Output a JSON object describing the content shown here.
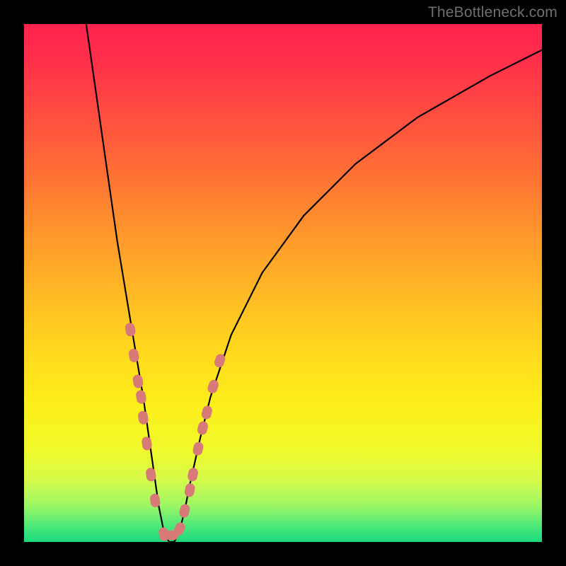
{
  "watermark": "TheBottleneck.com",
  "chart_data": {
    "type": "line",
    "title": "",
    "xlabel": "",
    "ylabel": "",
    "xlim": [
      0,
      100
    ],
    "ylim": [
      0,
      100
    ],
    "grid": false,
    "background_gradient": {
      "top": "#ff244e",
      "bottom": "#1bd97c"
    },
    "series": [
      {
        "name": "bottleneck-curve",
        "color": "#000000",
        "x": [
          12,
          14,
          16,
          18,
          20,
          21,
          22,
          23,
          24,
          25,
          26,
          27,
          28,
          29,
          30,
          31,
          32,
          34,
          36,
          40,
          46,
          54,
          64,
          76,
          90,
          100
        ],
        "y": [
          100,
          86,
          72,
          58,
          46,
          40,
          34,
          28,
          21,
          14,
          7,
          2,
          0,
          0,
          2,
          6,
          11,
          20,
          28,
          40,
          52,
          63,
          73,
          82,
          90,
          95
        ]
      }
    ],
    "markers": {
      "name": "data-points",
      "color": "#d77a78",
      "radius_px": 8,
      "points": [
        {
          "x": 20.5,
          "y": 41
        },
        {
          "x": 21.2,
          "y": 36
        },
        {
          "x": 22.0,
          "y": 31
        },
        {
          "x": 22.6,
          "y": 28
        },
        {
          "x": 23.0,
          "y": 24
        },
        {
          "x": 23.7,
          "y": 19
        },
        {
          "x": 24.5,
          "y": 13
        },
        {
          "x": 25.3,
          "y": 8
        },
        {
          "x": 27.0,
          "y": 1.5
        },
        {
          "x": 28.5,
          "y": 1.3
        },
        {
          "x": 30.0,
          "y": 2.5
        },
        {
          "x": 31.0,
          "y": 6
        },
        {
          "x": 32.0,
          "y": 10
        },
        {
          "x": 32.6,
          "y": 13
        },
        {
          "x": 33.6,
          "y": 18
        },
        {
          "x": 34.5,
          "y": 22
        },
        {
          "x": 35.3,
          "y": 25
        },
        {
          "x": 36.5,
          "y": 30
        },
        {
          "x": 37.8,
          "y": 35
        }
      ]
    }
  }
}
